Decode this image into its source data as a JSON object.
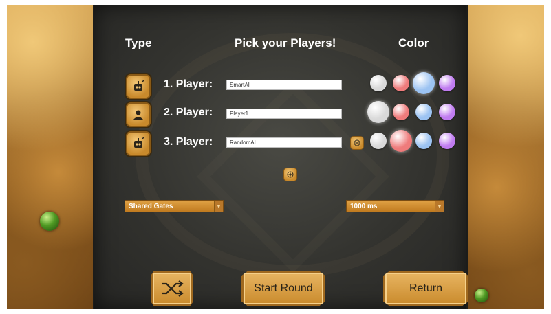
{
  "headers": {
    "type": "Type",
    "title": "Pick your Players!",
    "color": "Color"
  },
  "players": [
    {
      "label": "1. Player:",
      "name": "SmartAI",
      "type_icon": "robot-icon",
      "colors": [
        "#d9d9d9",
        "#ef7b7b",
        "#9cc3f2",
        "#c07cf0"
      ],
      "selected_color": 2
    },
    {
      "label": "2. Player:",
      "name": "Player1",
      "type_icon": "person-icon",
      "colors": [
        "#d9d9d9",
        "#ef7b7b",
        "#9cc3f2",
        "#c07cf0"
      ],
      "selected_color": 0
    },
    {
      "label": "3. Player:",
      "name": "RandomAI",
      "type_icon": "robot-icon",
      "colors": [
        "#d9d9d9",
        "#ef7b7b",
        "#9cc3f2",
        "#c07cf0"
      ],
      "selected_color": 1
    }
  ],
  "controls": {
    "remove_icon": "minus-icon",
    "add_icon": "plus-icon",
    "rule_dropdown": {
      "selected": "Shared Gates"
    },
    "speed_dropdown": {
      "selected": "1000 ms"
    },
    "shuffle_icon": "shuffle-icon",
    "start_label": "Start Round",
    "return_label": "Return"
  },
  "colors": {
    "accent": "#c98a2c",
    "panel": "#33332f",
    "text": "#ffffff"
  }
}
